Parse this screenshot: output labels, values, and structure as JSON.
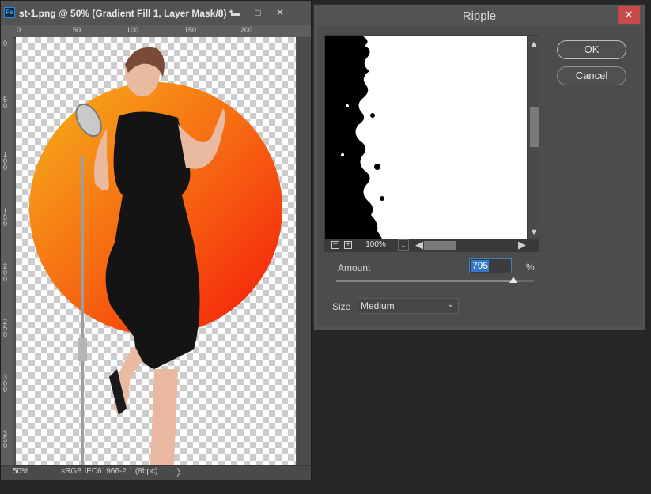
{
  "document": {
    "title": "st-1.png @ 50% (Gradient Fill 1, Layer Mask/8) *",
    "ruler_top_ticks": [
      "0",
      "50",
      "100",
      "150",
      "200"
    ],
    "ruler_left_ticks": [
      "0",
      "50",
      "100",
      "150",
      "200",
      "250",
      "300",
      "350"
    ],
    "status": {
      "zoom": "50%",
      "profile": "sRGB IEC61966-2.1 (8bpc)",
      "arrow": "〉"
    },
    "window_controls": {
      "minimize": "▬",
      "maximize": "□",
      "close": "✕"
    }
  },
  "dialog": {
    "title": "Ripple",
    "close_glyph": "✕",
    "ok_label": "OK",
    "cancel_label": "Cancel",
    "preview": {
      "zoom": "100%",
      "zoom_out": "−",
      "zoom_in": "+",
      "scroll_up": "▲",
      "scroll_down": "▼",
      "scroll_left": "◀",
      "scroll_right": "▶",
      "dropdown": "⌄"
    },
    "amount": {
      "label": "Amount",
      "value": "795",
      "unit": "%",
      "min": -999,
      "max": 999
    },
    "size": {
      "label": "Size",
      "value": "Medium",
      "chevron": "⌄"
    }
  },
  "colors": {
    "accent_selection": "#3578c7",
    "gradient_start": "#f5a21a",
    "gradient_end": "#f62a0a",
    "close_button": "#c94a4a"
  }
}
